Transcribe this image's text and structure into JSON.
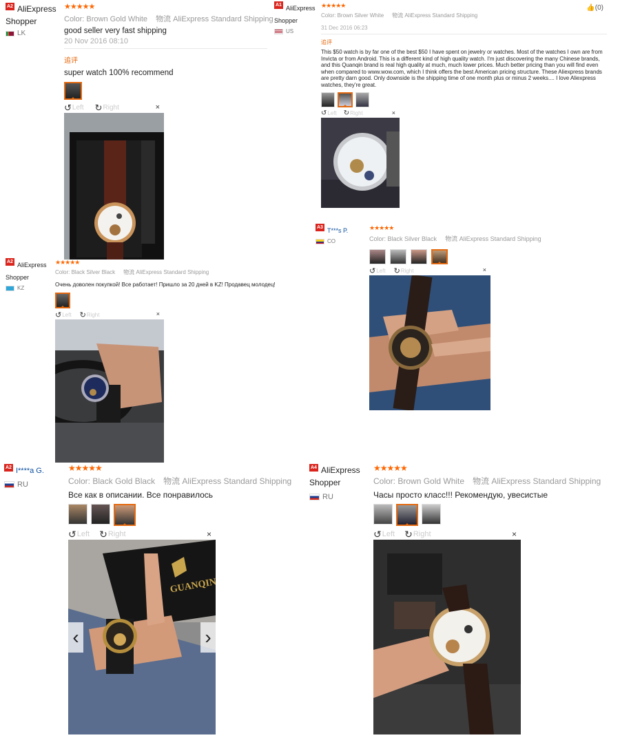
{
  "reviews": [
    {
      "level": "A2",
      "user": "AliExpress Shopper",
      "country": "LK",
      "stars": "★★★★★",
      "color_label": "Color:",
      "color": "Brown Gold White",
      "shipping_icon": "物流",
      "shipping": "AliExpress Standard Shipping",
      "text": "good seller very fast shipping",
      "date": "20 Nov 2016 08:10",
      "followup_label": "追评",
      "followup": "super watch 100% recommend",
      "rotate_left": "Left",
      "rotate_right": "Right",
      "close": "×"
    },
    {
      "level": "A1",
      "user": "AliExpress Shopper",
      "country": "US",
      "stars": "★★★★★",
      "color_label": "Color:",
      "color": "Brown Silver White",
      "shipping_icon": "物流",
      "shipping": "AliExpress Standard Shipping",
      "date": "31 Dec 2016 06:23",
      "followup_label": "追评",
      "followup": "This $50 watch is by far one of the best $50 I have spent on jewelry or watches. Most of the watches I own are from Invicta or from Android. This is a different kind of high quality watch. I'm just discovering the many Chinese brands, and this Quanqin brand is real high quality at much, much lower prices. Much better pricing than you will find even when compared to www.wow.com, which I think offers the best American pricing structure. These Aliexpress brands are pretty darn good. Only downside is the shipping time of one month plus or minus 2 weeks.... I love Aliexpress watches, they're great.",
      "helpful": "(0)",
      "rotate_left": "Left",
      "rotate_right": "Right",
      "close": "×"
    },
    {
      "level": "A2",
      "user": "AliExpress Shopper",
      "country": "KZ",
      "stars": "★★★★★",
      "color_label": "Color:",
      "color": "Black Silver Black",
      "shipping_icon": "物流",
      "shipping": "AliExpress Standard Shipping",
      "text": "Очень доволен покупкой! Все работает! Пришло за 20 дней в KZ! Продавец молодец!",
      "rotate_left": "Left",
      "rotate_right": "Right",
      "close": "×"
    },
    {
      "level": "A3",
      "user": "T***s P.",
      "country": "CO",
      "stars": "★★★★★",
      "color_label": "Color:",
      "color": "Black Silver Black",
      "shipping_icon": "物流",
      "shipping": "AliExpress Standard Shipping",
      "rotate_left": "Left",
      "rotate_right": "Right",
      "close": "×"
    },
    {
      "level": "A2",
      "user": "I****a G.",
      "country": "RU",
      "stars": "★★★★★",
      "color_label": "Color:",
      "color": "Black Gold Black",
      "shipping_icon": "物流",
      "shipping": "AliExpress Standard Shipping",
      "text": "Все как в описании. Все понравилось",
      "brand_text": "GUANQIN",
      "rotate_left": "Left",
      "rotate_right": "Right",
      "close": "×",
      "prev": "‹",
      "next": "›"
    },
    {
      "level": "A4",
      "user": "AliExpress Shopper",
      "country": "RU",
      "stars": "★★★★★",
      "color_label": "Color:",
      "color": "Brown Gold White",
      "shipping_icon": "物流",
      "shipping": "AliExpress Standard Shipping",
      "text": "Часы просто класс!!! Рекомендую, увесистые",
      "rotate_left": "Left",
      "rotate_right": "Right",
      "close": "×"
    }
  ]
}
